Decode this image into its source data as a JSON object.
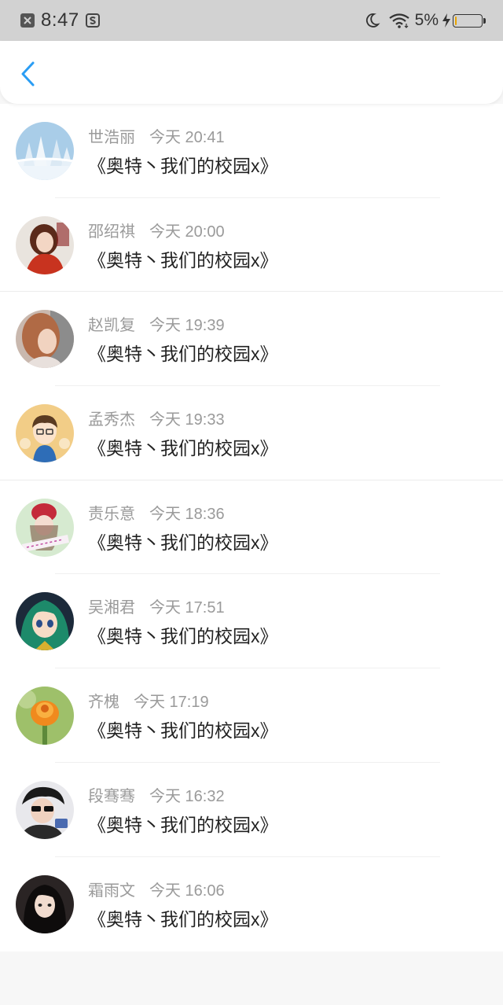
{
  "status_bar": {
    "time": "8:47",
    "battery_percent": "5%",
    "battery_level": 0.05,
    "icons": [
      "notification-x-icon",
      "app-s-icon",
      "moon-icon",
      "wifi-icon",
      "charging-bolt-icon",
      "battery-icon"
    ]
  },
  "nav": {
    "back_icon": "chevron-left-icon",
    "accent_color": "#2a9df4"
  },
  "comments": [
    {
      "name": "世浩丽",
      "time": "今天 20:41",
      "text": "《奥特丶我们的校园x》",
      "avatar": "snowy-trees-avatar"
    },
    {
      "name": "邵绍祺",
      "time": "今天 20:00",
      "text": "《奥特丶我们的校园x》",
      "avatar": "girl-red-sweater-avatar"
    },
    {
      "name": "赵凯复",
      "time": "今天 19:39",
      "text": "《奥特丶我们的校园x》",
      "avatar": "girl-profile-avatar"
    },
    {
      "name": "孟秀杰",
      "time": "今天 19:33",
      "text": "《奥特丶我们的校园x》",
      "avatar": "cartoon-boy-avatar"
    },
    {
      "name": "责乐意",
      "time": "今天 18:36",
      "text": "《奥特丶我们的校园x》",
      "avatar": "girl-red-hat-avatar"
    },
    {
      "name": "吴湘君",
      "time": "今天 17:51",
      "text": "《奥特丶我们的校园x》",
      "avatar": "anime-girl-green-hair-avatar"
    },
    {
      "name": "齐槐",
      "time": "今天 17:19",
      "text": "《奥特丶我们的校园x》",
      "avatar": "orange-flower-avatar"
    },
    {
      "name": "段骞骞",
      "time": "今天 16:32",
      "text": "《奥特丶我们的校园x》",
      "avatar": "sunglasses-person-avatar"
    },
    {
      "name": "霜雨文",
      "time": "今天 16:06",
      "text": "《奥特丶我们的校园x》",
      "avatar": "dark-hair-girl-avatar"
    }
  ]
}
